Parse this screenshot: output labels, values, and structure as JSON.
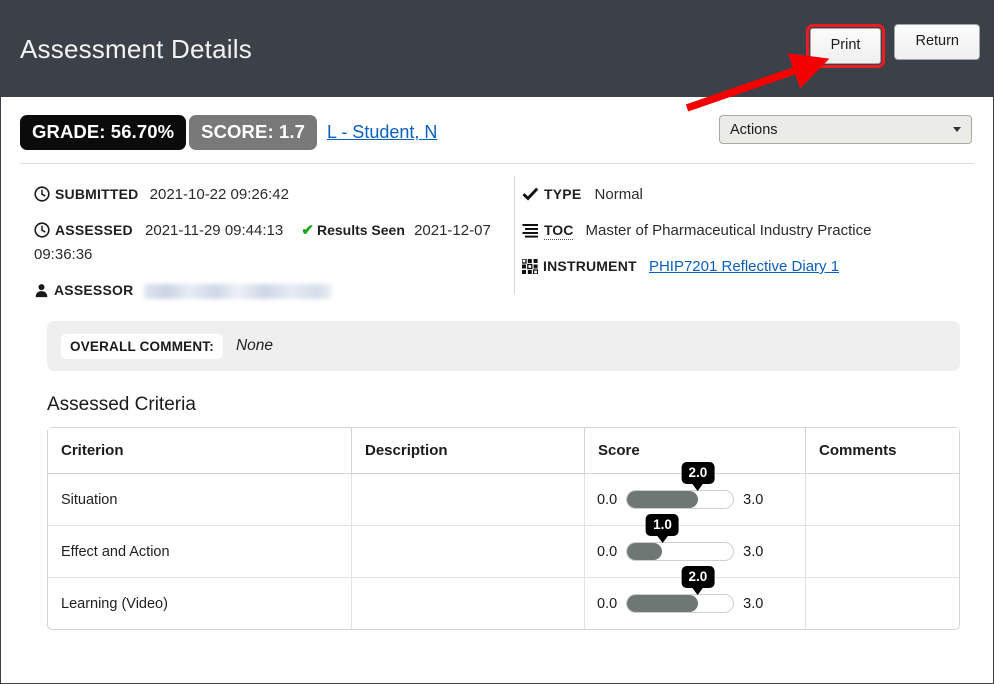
{
  "header": {
    "title": "Assessment Details",
    "print_label": "Print",
    "return_label": "Return"
  },
  "summary": {
    "grade_badge": "GRADE: 56.70%",
    "score_badge": "SCORE: 1.7",
    "student_link": "L - Student, N",
    "actions_label": "Actions"
  },
  "meta": {
    "submitted_label": "SUBMITTED",
    "submitted_value": "2021-10-22 09:26:42",
    "assessed_label": "ASSESSED",
    "assessed_value": "2021-11-29 09:44:13",
    "results_seen_label": "Results Seen",
    "results_seen_value": "2021-12-07 09:36:36",
    "assessor_label": "ASSESSOR",
    "assessor_value": "",
    "type_label": "TYPE",
    "type_value": "Normal",
    "toc_label": "TOC",
    "toc_value": "Master of Pharmaceutical Industry Practice",
    "instrument_label": "INSTRUMENT",
    "instrument_value": "PHIP7201 Reflective Diary 1"
  },
  "overall_comment": {
    "label": "OVERALL COMMENT:",
    "value": "None"
  },
  "criteria_section": {
    "title": "Assessed Criteria",
    "columns": [
      "Criterion",
      "Description",
      "Score",
      "Comments"
    ],
    "rows": [
      {
        "criterion": "Situation",
        "description": "",
        "score_min": "0.0",
        "score_max": "3.0",
        "score_value": "2.0",
        "score_pct": 66.7,
        "comments": ""
      },
      {
        "criterion": "Effect and Action",
        "description": "",
        "score_min": "0.0",
        "score_max": "3.0",
        "score_value": "1.0",
        "score_pct": 33.3,
        "comments": ""
      },
      {
        "criterion": "Learning (Video)",
        "description": "",
        "score_min": "0.0",
        "score_max": "3.0",
        "score_value": "2.0",
        "score_pct": 66.7,
        "comments": ""
      }
    ]
  },
  "annotation": {
    "highlight_color": "#ee1b23",
    "arrow_color": "#f50000",
    "target": "print-button"
  },
  "colors": {
    "header_bg": "#3c4048",
    "grade_badge_bg": "#0b0b0b",
    "score_badge_bg": "#797979",
    "link": "#0b5fbd",
    "slider_fill": "#6f7775",
    "check_green": "#1aa81a"
  }
}
